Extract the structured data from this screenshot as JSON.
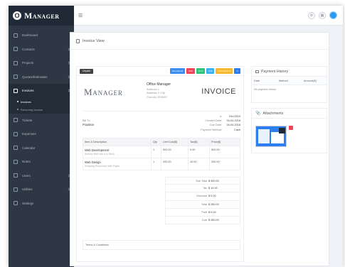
{
  "brand": {
    "letter": "O",
    "name": "Manager"
  },
  "sidebar": {
    "items": [
      {
        "label": "Dashboard"
      },
      {
        "label": "Contacts"
      },
      {
        "label": "Projects"
      },
      {
        "label": "Quotes/Estimates"
      },
      {
        "label": "Invoices"
      },
      {
        "label": "Tickets"
      },
      {
        "label": "Expenses"
      },
      {
        "label": "Calendar"
      },
      {
        "label": "Notes"
      },
      {
        "label": "Users"
      },
      {
        "label": "Utilities"
      },
      {
        "label": "Settings"
      }
    ],
    "invoice_sub": [
      "Invoices",
      "Recurring Invoice"
    ]
  },
  "topbar": {
    "menu_icon": "☰"
  },
  "page": {
    "title": "Invoice View"
  },
  "invoice": {
    "status": "Unpaid",
    "buttons": [
      "Send Email",
      "PDF",
      "Print",
      "Edit",
      "Add Payment",
      "✎"
    ],
    "logo_text": "Manager",
    "company": {
      "name": "Office Manager",
      "address1": "Address 1",
      "address2": "Address 2 City",
      "country": "Country 000000"
    },
    "title": "INVOICE",
    "bill_to_label": "Bill To",
    "customer": "Popalov",
    "meta": [
      {
        "k": "#:",
        "v": "INV-0019"
      },
      {
        "k": "Created Date:",
        "v": "04-04-2018"
      },
      {
        "k": "Due Date:",
        "v": "04-04-2018"
      },
      {
        "k": "Payment Method:",
        "v": "Cash"
      }
    ],
    "columns": [
      "Item & Description",
      "Qty",
      "Unit Cost($)",
      "Tax($)",
      "Price($)"
    ],
    "rows": [
      {
        "title": "Web Development",
        "desc": "Develop Web from A to Z(full)",
        "qty": "1",
        "unit": "500.00",
        "tax": "0.00",
        "price": "500.00"
      },
      {
        "title": "Web Design",
        "desc": "Designing Responsive Web Pages",
        "qty": "1",
        "unit": "200.00",
        "tax": "10.00",
        "price": "200.00"
      }
    ],
    "totals": [
      {
        "k": "Sub Total",
        "v": "$ 300.00"
      },
      {
        "k": "Tax",
        "v": "$ 10.00"
      },
      {
        "k": "Discount",
        "v": "$ 0.00"
      },
      {
        "k": "Total",
        "v": "$ 280.00"
      },
      {
        "k": "Paid",
        "v": "$ 0.00"
      },
      {
        "k": "Due",
        "v": "$ 280.00"
      }
    ],
    "terms_label": "Terms & Conditions"
  },
  "payment_history": {
    "title": "Payment History",
    "columns": [
      "Date",
      "Method",
      "Amount($)"
    ],
    "empty": "No payment history"
  },
  "attachments": {
    "title": "Attachments"
  },
  "colors": {
    "sidebar": "#2d3844",
    "accent": "#2a9af2",
    "danger": "#f0445a"
  }
}
